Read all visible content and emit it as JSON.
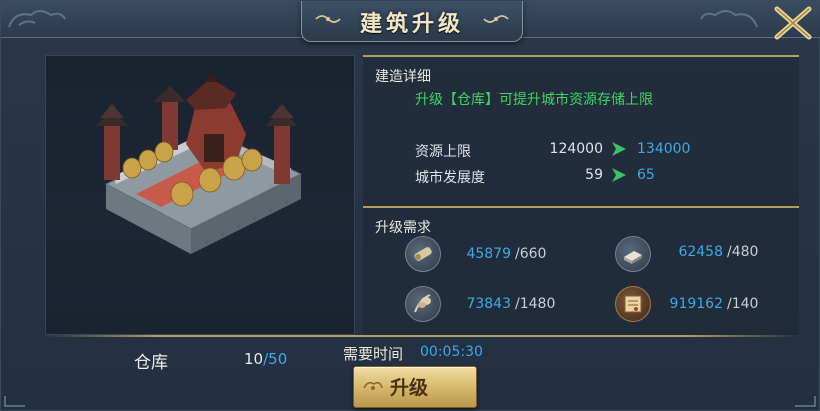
{
  "window": {
    "title": "建筑升级"
  },
  "building": {
    "name": "仓库",
    "level": "10",
    "max_level": "/50"
  },
  "details": {
    "section_title": "建造详细",
    "description": "升级【仓库】可提升城市资源存储上限",
    "stats": [
      {
        "label": "资源上限",
        "current": "124000",
        "next": "134000"
      },
      {
        "label": "城市发展度",
        "current": "59",
        "next": "65"
      }
    ]
  },
  "requirements": {
    "section_title": "升级需求",
    "items": [
      {
        "icon": "wood-icon",
        "have": "45879",
        "need": "/660"
      },
      {
        "icon": "iron-icon",
        "have": "62458",
        "need": "/480"
      },
      {
        "icon": "grain-icon",
        "have": "73843",
        "need": "/1480"
      },
      {
        "icon": "scroll-icon",
        "have": "919162",
        "need": "/140"
      }
    ]
  },
  "footer": {
    "time_label": "需要时间",
    "time_value": "00:05:30",
    "upgrade_label": "升级"
  },
  "colors": {
    "accent_blue": "#3fa9e6",
    "desc_green": "#3fd465",
    "gold": "#b79d5c",
    "arrow_green": "#39c46a"
  }
}
